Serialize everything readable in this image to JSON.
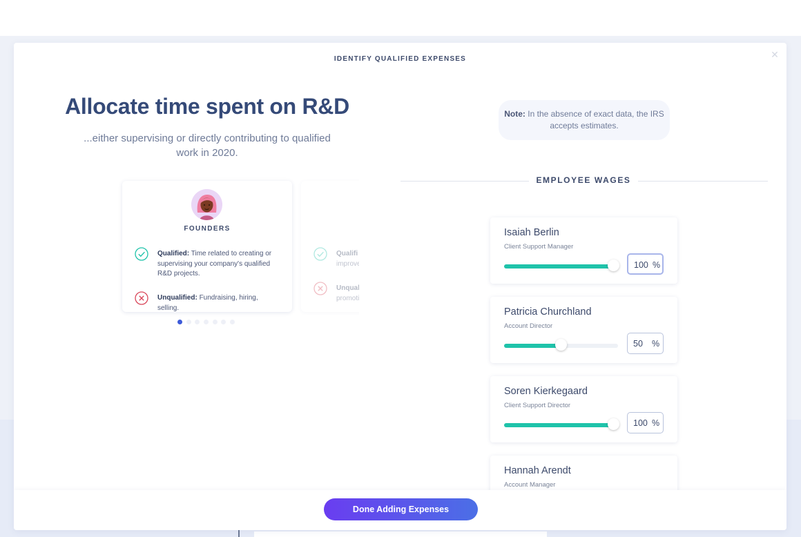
{
  "modal": {
    "eyebrow": "IDENTIFY QUALIFIED EXPENSES",
    "close_icon": "close-icon",
    "headline": "Allocate time spent on R&D",
    "subhead": "...either supervising or directly contributing to qualified work in 2020."
  },
  "carousel": {
    "active_index": 0,
    "dot_count": 7,
    "cards": [
      {
        "title": "FOUNDERS",
        "avatar_icon": "founder-avatar-icon",
        "qualified_label": "Qualified:",
        "qualified_text": "Time related to creating or supervising your company's qualified R&D projects.",
        "unqualified_label": "Unqualified:",
        "unqualified_text": "Fundraising, hiring, selling."
      },
      {
        "qualified_label": "Qualifi",
        "qualified_text": "improve",
        "unqualified_label": "Unqual",
        "unqualified_text": "promoti"
      }
    ]
  },
  "note": {
    "label": "Note:",
    "text": "In the absence of exact data, the IRS accepts estimates."
  },
  "wages": {
    "title": "EMPLOYEE WAGES",
    "unit": "%",
    "employees": [
      {
        "name": "Isaiah Berlin",
        "role": "Client Support Manager",
        "percent": 100,
        "percent_text": "100"
      },
      {
        "name": "Patricia Churchland",
        "role": "Account Director",
        "percent": 50,
        "percent_text": "50"
      },
      {
        "name": "Soren Kierkegaard",
        "role": "Client Support Director",
        "percent": 100,
        "percent_text": "100"
      },
      {
        "name": "Hannah Arendt",
        "role": "Account Manager"
      }
    ]
  },
  "footer": {
    "done_label": "Done Adding Expenses"
  },
  "colors": {
    "accent_teal": "#1fc3aa",
    "button_gradient_start": "#6a3df0",
    "button_gradient_end": "#4b6fe6",
    "qualified_green": "#1fc3aa",
    "unqualified_red": "#d9475a",
    "active_dot": "#3d5bd9"
  }
}
